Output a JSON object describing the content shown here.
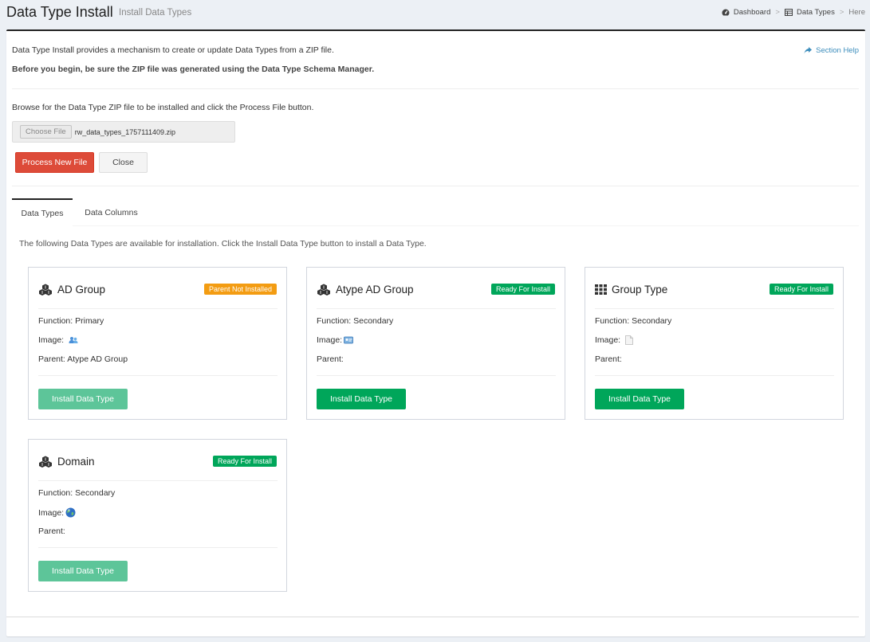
{
  "header": {
    "title": "Data Type Install",
    "subtitle": "Install Data Types",
    "breadcrumb": {
      "dashboard": "Dashboard",
      "data_types": "Data Types",
      "here": "Here",
      "separator": ">"
    }
  },
  "intro": {
    "description": "Data Type Install provides a mechanism to create or update Data Types from a ZIP file.",
    "warning": "Before you begin, be sure the ZIP file was generated using the Data Type Schema Manager.",
    "section_help": "Section Help"
  },
  "upload": {
    "label": "Browse for the Data Type ZIP file to be installed and click the Process File button.",
    "choose_label": "Choose File",
    "file_name": "rw_data_types_1757111409.zip",
    "process_label": "Process New File",
    "close_label": "Close"
  },
  "tabs": [
    {
      "label": "Data Types",
      "active": true
    },
    {
      "label": "Data Columns",
      "active": false
    }
  ],
  "tab_description": "The following Data Types are available for installation. Click the Install Data Type button to install a Data Type.",
  "cards": [
    {
      "title": "AD Group",
      "icon": "cubes-icon",
      "badge": "Parent Not Installed",
      "badge_color": "#f39c12",
      "function": "Function: Primary",
      "image_label": "Image:",
      "image_icon": "users-icon",
      "parent": "Parent: Atype AD Group",
      "button": "Install Data Type",
      "button_disabled": true
    },
    {
      "title": "Atype AD Group",
      "icon": "cubes-icon",
      "badge": "Ready For Install",
      "badge_color": "#00a65a",
      "function": "Function: Secondary",
      "image_label": "Image:",
      "image_icon": "id-card-icon",
      "parent": "Parent:",
      "button": "Install Data Type",
      "button_disabled": false
    },
    {
      "title": "Group Type",
      "icon": "grid-icon",
      "badge": "Ready For Install",
      "badge_color": "#00a65a",
      "function": "Function: Secondary",
      "image_label": "Image:",
      "image_icon": "document-icon",
      "parent": "Parent:",
      "button": "Install Data Type",
      "button_disabled": false
    },
    {
      "title": "Domain",
      "icon": "cubes-icon",
      "badge": "Ready For Install",
      "badge_color": "#00a65a",
      "function": "Function: Secondary",
      "image_label": "Image:",
      "image_icon": "globe-icon",
      "parent": "Parent:",
      "button": "Install Data Type",
      "button_disabled": true
    }
  ],
  "colors": {
    "danger": "#dd4b39",
    "success": "#00a65a",
    "warning": "#f39c12",
    "link": "#3c8dbc"
  }
}
